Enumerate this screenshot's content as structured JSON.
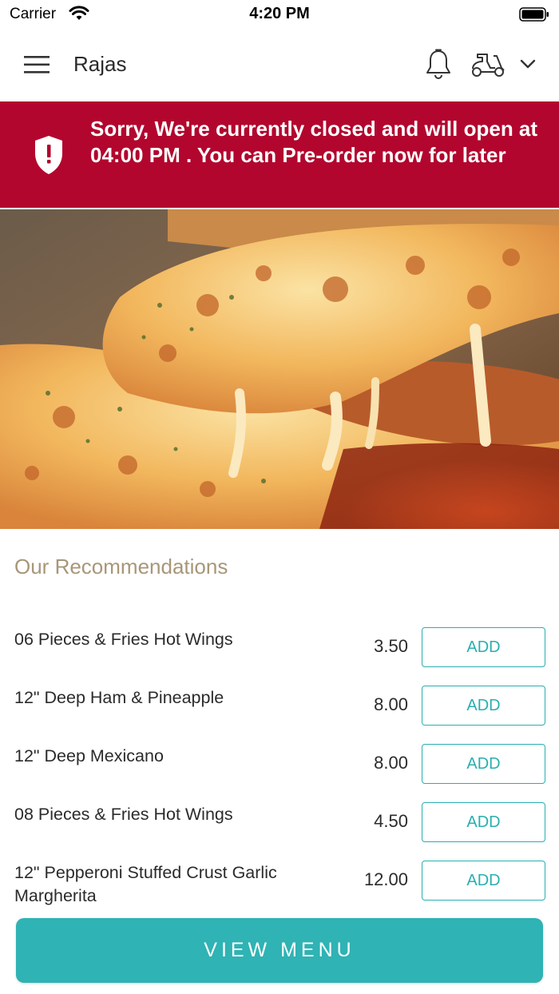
{
  "status_bar": {
    "carrier": "Carrier",
    "time": "4:20 PM"
  },
  "header": {
    "restaurant_name": "Rajas"
  },
  "banner": {
    "message": "Sorry, We're currently closed and will open at 04:00 PM . You can Pre-order now for later",
    "color": "#b2062e"
  },
  "recommendations": {
    "title": "Our Recommendations",
    "items": [
      {
        "name": "06 Pieces & Fries Hot Wings",
        "price": "3.50",
        "button": "ADD"
      },
      {
        "name": "12\" Deep Ham & Pineapple",
        "price": "8.00",
        "button": "ADD"
      },
      {
        "name": "12\" Deep Mexicano",
        "price": "8.00",
        "button": "ADD"
      },
      {
        "name": "08 Pieces & Fries Hot Wings",
        "price": "4.50",
        "button": "ADD"
      },
      {
        "name": "12\" Pepperoni Stuffed Crust Garlic Margherita",
        "price": "12.00",
        "button": "ADD"
      }
    ]
  },
  "footer": {
    "view_menu_label": "VIEW MENU",
    "accent": "#2fb3b4"
  },
  "icons": [
    "wifi-icon",
    "battery-icon",
    "menu-icon",
    "bell-icon",
    "delivery-scooter-icon",
    "chevron-down-icon",
    "shield-alert-icon"
  ]
}
